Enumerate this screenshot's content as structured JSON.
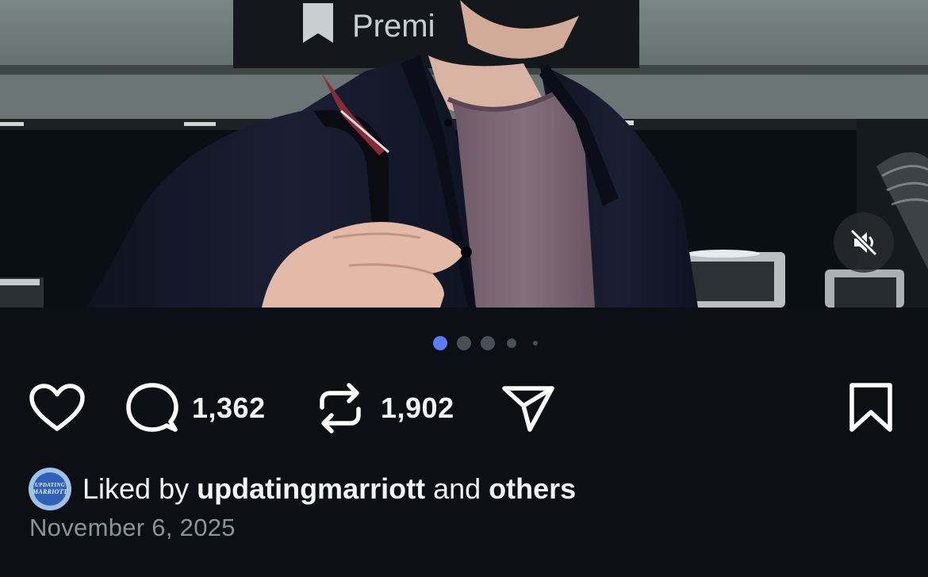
{
  "post": {
    "media": {
      "description_sign_text": "Premi",
      "muted": true,
      "carousel_dot_count": 5,
      "carousel_active_index": 0
    },
    "actions": {
      "comment_count": "1,362",
      "repost_count": "1,902"
    },
    "likes": {
      "prefix": "Liked by ",
      "user": "updatingmarriott",
      "connector": " and ",
      "suffix": "others",
      "avatar_line1": "UPDATING",
      "avatar_line2": "MARRIOTT"
    },
    "date": "November 6, 2025"
  },
  "colors": {
    "background": "#0c0f14",
    "active_dot": "#5b7cf6",
    "inactive_dot": "#4a4f57",
    "text_primary": "#f3f4f6",
    "text_secondary": "#8e939b"
  },
  "icons": {
    "mute": "speaker-muted-icon",
    "like": "heart-icon",
    "comment": "comment-bubble-icon",
    "repost": "repost-icon",
    "share": "send-icon",
    "save": "bookmark-icon"
  }
}
